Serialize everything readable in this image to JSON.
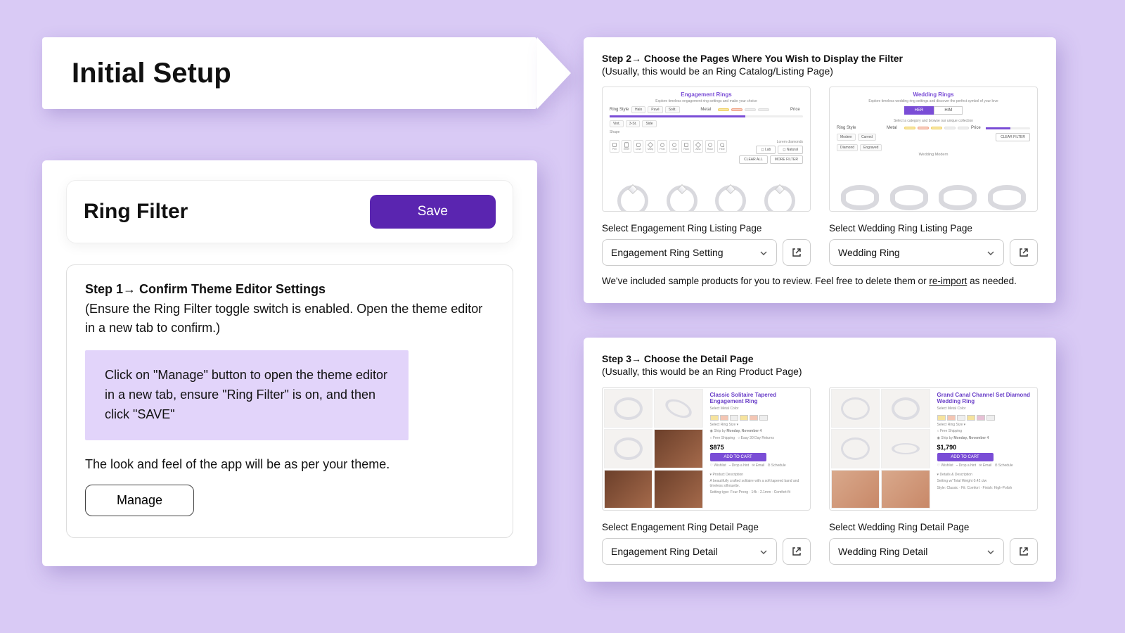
{
  "hero": {
    "title": "Initial Setup"
  },
  "left": {
    "filter_title": "Ring Filter",
    "save_label": "Save",
    "step1_heading": "Step 1→  Confirm Theme Editor Settings",
    "step1_sub": "(Ensure the Ring Filter toggle switch is enabled. Open the theme editor in a new tab to confirm.)",
    "callout": "Click on \"Manage\" button to open the theme editor in a new tab, ensure \"Ring Filter\" is on, and then click \"SAVE\"",
    "look_feel": "The look and feel of the app will be as per your theme.",
    "manage_label": "Manage"
  },
  "step2": {
    "heading": "Step 2→ Choose the Pages Where You Wish to Display the Filter",
    "sub": "(Usually, this would be an Ring Catalog/Listing Page)",
    "left": {
      "preview_title": "Engagement Rings",
      "label": "Select Engagement Ring Listing Page",
      "value": "Engagement Ring Setting"
    },
    "right": {
      "preview_title": "Wedding Rings",
      "label": "Select Wedding Ring Listing Page",
      "value": "Wedding Ring"
    },
    "footnote_pre": "We've included sample products for you to review. Feel free to delete them or ",
    "footnote_link": "re-import",
    "footnote_post": " as needed."
  },
  "step3": {
    "heading": "Step 3→ Choose the Detail Page",
    "sub": "(Usually, this would be an Ring Product Page)",
    "left": {
      "product_name": "Classic Solitaire Tapered Engagement Ring",
      "price": "$875",
      "label": "Select Engagement Ring Detail Page",
      "value": "Engagement Ring Detail"
    },
    "right": {
      "product_name": "Grand Canal Channel Set Diamond Wedding Ring",
      "price": "$1,790",
      "label": "Select Wedding Ring Detail Page",
      "value": "Wedding Ring Detail"
    }
  }
}
